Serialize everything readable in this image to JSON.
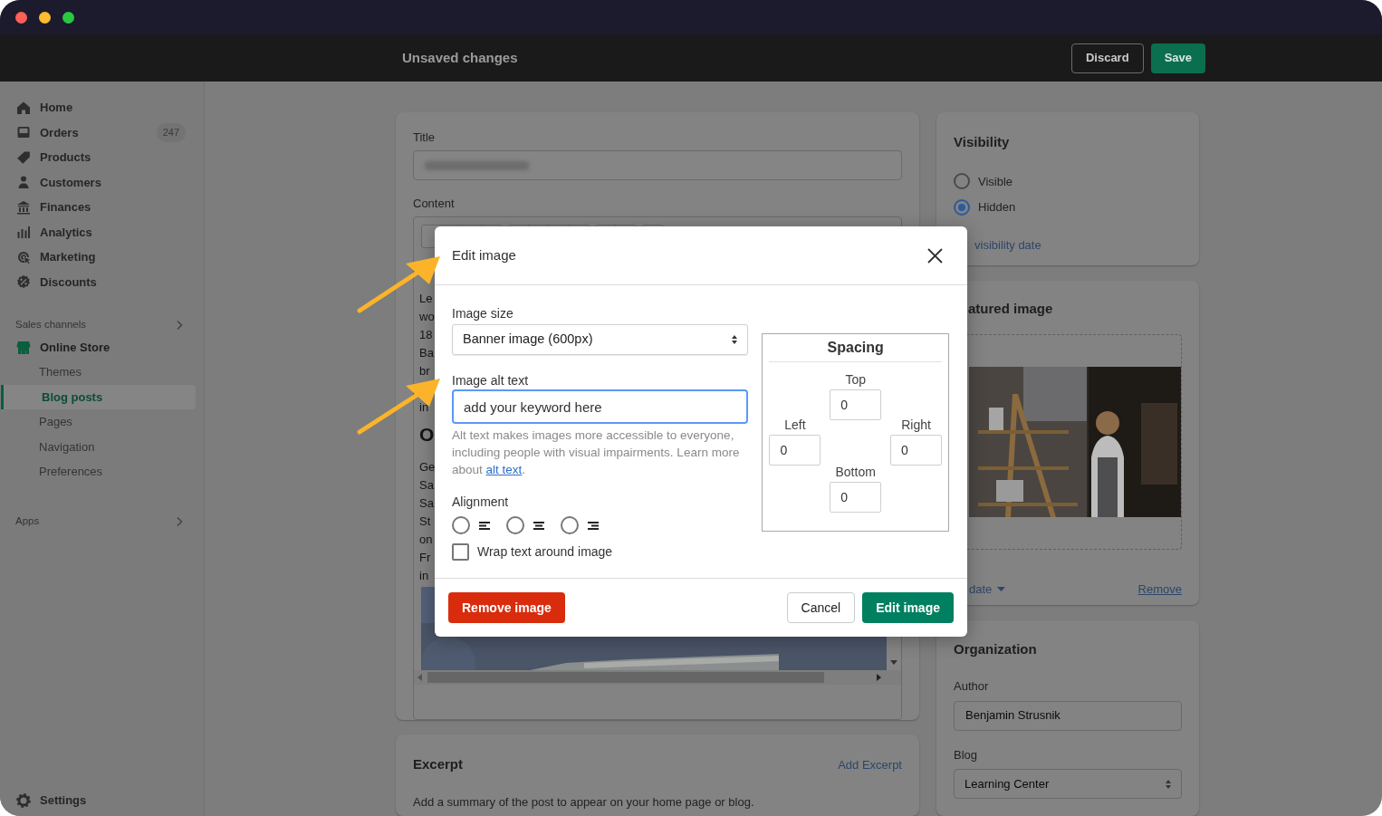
{
  "top_bar": {
    "title": "Unsaved changes",
    "buttons": [
      {
        "label": "Discard",
        "kind": "secondary"
      },
      {
        "label": "Save",
        "kind": "primary"
      }
    ]
  },
  "sidebar": {
    "items": [
      {
        "label": "Home",
        "selected": false
      },
      {
        "label": "Orders",
        "badge": "247",
        "selected": false
      },
      {
        "label": "Products",
        "selected": false
      },
      {
        "label": "Customers",
        "selected": false
      },
      {
        "label": "Finances",
        "selected": false
      },
      {
        "label": "Analytics",
        "selected": false
      },
      {
        "label": "Marketing",
        "selected": false
      },
      {
        "label": "Discounts",
        "selected": false
      }
    ],
    "sections": [
      {
        "label": "Sales channels",
        "items": [
          {
            "label": "Online Store",
            "selected": false,
            "children": [
              {
                "label": "Themes",
                "selected": false
              },
              {
                "label": "Blog posts",
                "selected": true
              },
              {
                "label": "Pages",
                "selected": false
              },
              {
                "label": "Navigation",
                "selected": false
              },
              {
                "label": "Preferences",
                "selected": false
              }
            ]
          }
        ]
      },
      {
        "label": "Apps"
      }
    ],
    "footer_item": {
      "label": "Settings",
      "selected": false
    }
  },
  "post_card": {
    "title_label": "Title",
    "content_label": "Content",
    "editor_lines": [
      "Le",
      "wo",
      "18",
      "Ba",
      "br"
    ],
    "editor_line_after_gap": "in",
    "editor_heading": "O",
    "editor_lines_after": [
      "Ge",
      "Sa",
      "Sa",
      "St",
      "on",
      "Fr",
      "in"
    ]
  },
  "excerpt_card": {
    "title": "Excerpt",
    "action": "Add Excerpt",
    "description": "Add a summary of the post to appear on your home page or blog."
  },
  "visibility_card": {
    "title": "Visibility",
    "options": [
      {
        "label": "Visible",
        "selected": false
      },
      {
        "label": "Hidden",
        "selected": true
      }
    ],
    "link": "visibility date"
  },
  "featured_image_card": {
    "title": "atured image",
    "date_link": "date",
    "remove_link": "Remove"
  },
  "organization_card": {
    "title": "Organization",
    "author": {
      "label": "Author",
      "value": "Benjamin Strusnik"
    },
    "blog": {
      "label": "Blog",
      "value": "Learning Center"
    }
  },
  "dialog": {
    "title": "Edit image",
    "image_size": {
      "label": "Image size",
      "value": "Banner image (600px)"
    },
    "alt_text": {
      "label": "Image alt text",
      "value": "add your keyword here",
      "help": "Alt text makes images more accessible to everyone, including people with visual impairments. Learn more about ",
      "help_link": "alt text",
      "help_end": "."
    },
    "alignment": {
      "label": "Alignment",
      "options": [
        {
          "kind": "left",
          "selected": false
        },
        {
          "kind": "center",
          "selected": false
        },
        {
          "kind": "right",
          "selected": false
        }
      ]
    },
    "wrap": {
      "label": "Wrap text around image",
      "checked": false
    },
    "spacing": {
      "title": "Spacing",
      "top": {
        "label": "Top",
        "value": "0"
      },
      "left": {
        "label": "Left",
        "value": "0"
      },
      "right": {
        "label": "Right",
        "value": "0"
      },
      "bottom": {
        "label": "Bottom",
        "value": "0"
      }
    },
    "buttons": [
      {
        "label": "Remove image",
        "kind": "destructive"
      },
      {
        "label": "Cancel",
        "kind": "secondary"
      },
      {
        "label": "Edit image",
        "kind": "primary"
      }
    ]
  }
}
